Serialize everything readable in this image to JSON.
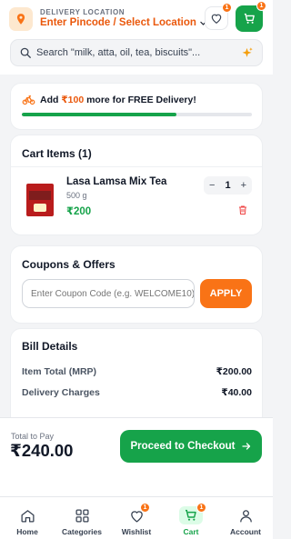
{
  "header": {
    "location_label": "DELIVERY LOCATION",
    "location_value": "Enter Pincode / Select Location",
    "wishlist_count": "1",
    "cart_count": "1",
    "search_placeholder": "Search \"milk, atta, oil, tea, biscuits\"..."
  },
  "delivery": {
    "prefix": "Add ",
    "amount": "₹100",
    "suffix": " more for FREE Delivery!",
    "progress_percent": 67
  },
  "cart": {
    "title": "Cart Items (1)",
    "item": {
      "name": "Lasa Lamsa Mix Tea",
      "weight": "500 g",
      "price": "₹200",
      "quantity": "1",
      "minus": "−",
      "plus": "+"
    }
  },
  "coupons": {
    "title": "Coupons & Offers",
    "input_placeholder": "Enter Coupon Code (e.g. WELCOME10)",
    "apply_label": "APPLY"
  },
  "bill": {
    "title": "Bill Details",
    "rows": [
      {
        "label": "Item Total (MRP)",
        "value": "₹200.00"
      },
      {
        "label": "Delivery Charges",
        "value": "₹40.00"
      }
    ]
  },
  "footer": {
    "total_label": "Total to Pay",
    "total_value": "₹240.00",
    "checkout_label": "Proceed to Checkout"
  },
  "tabs": [
    {
      "label": "Home",
      "icon": "home-icon"
    },
    {
      "label": "Categories",
      "icon": "grid-icon"
    },
    {
      "label": "Wishlist",
      "icon": "heart-icon",
      "badge": "1"
    },
    {
      "label": "Cart",
      "icon": "cart-icon",
      "badge": "1",
      "active": true
    },
    {
      "label": "Account",
      "icon": "user-icon"
    }
  ],
  "colors": {
    "brand_green": "#16a34a",
    "accent_orange": "#f97316"
  }
}
